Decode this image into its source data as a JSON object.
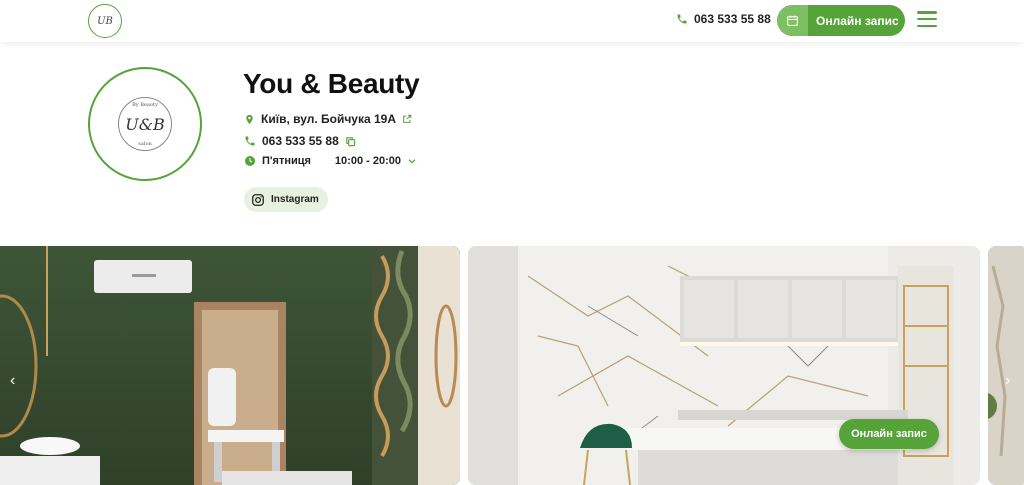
{
  "header": {
    "logo_monogram": "UB",
    "phone": "063 533 55 88",
    "cta_label": "Онлайн запис"
  },
  "salon": {
    "logo_monogram": "U&B",
    "logo_top_text": "By Beauty",
    "logo_bottom_text": "salon",
    "name": "You & Beauty",
    "address": "Київ, вул. Бойчука 19А",
    "phone": "063 533 55 88",
    "hours_day": "П'ятниця",
    "hours_time": "10:00 - 20:00",
    "instagram_label": "Instagram"
  },
  "gallery": {
    "book_label": "Онлайн запис",
    "prev_icon": "‹",
    "next_icon": "›"
  },
  "colors": {
    "accent": "#56a33a",
    "accent_light": "#e6f1df"
  }
}
